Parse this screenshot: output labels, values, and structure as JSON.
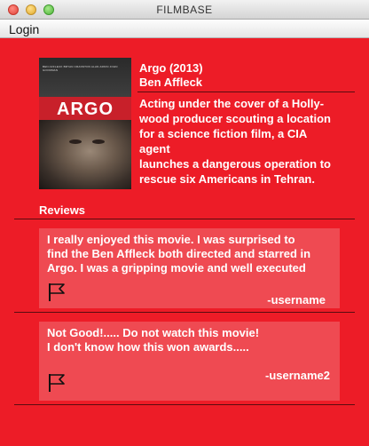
{
  "window": {
    "title": "FILMBASE",
    "controls": [
      "close-icon",
      "minimize-icon",
      "maximize-icon"
    ]
  },
  "menu": {
    "login_label": "Login"
  },
  "poster": {
    "word": "ARGO",
    "credits": "BEN AFFLECK   BRYAN CRANSTON   ALAN ARKIN   JOHN GOODMAN"
  },
  "movie": {
    "title": "Argo (2013)",
    "director": "Ben Affleck",
    "description_lines": [
      "Acting under the cover of a Holly-",
      "wood producer scouting a location",
      "for a science fiction film, a CIA agent",
      "launches a dangerous operation to",
      "rescue six Americans in Tehran."
    ]
  },
  "reviews_heading": "Reviews",
  "reviews": [
    {
      "text_lines": [
        "I really enjoyed this movie. I was surprised to",
        "find the Ben Affleck both directed and starred in",
        "Argo. I was a gripping movie and well executed"
      ],
      "username": "-username"
    },
    {
      "text_lines": [
        "Not Good!..... Do not watch this movie!",
        "I don't know how this won awards....."
      ],
      "username": "-username2"
    }
  ],
  "colors": {
    "background": "#ed1c27",
    "card": "#ef4a52",
    "divider": "#5a0c10",
    "text": "#ffffff"
  }
}
